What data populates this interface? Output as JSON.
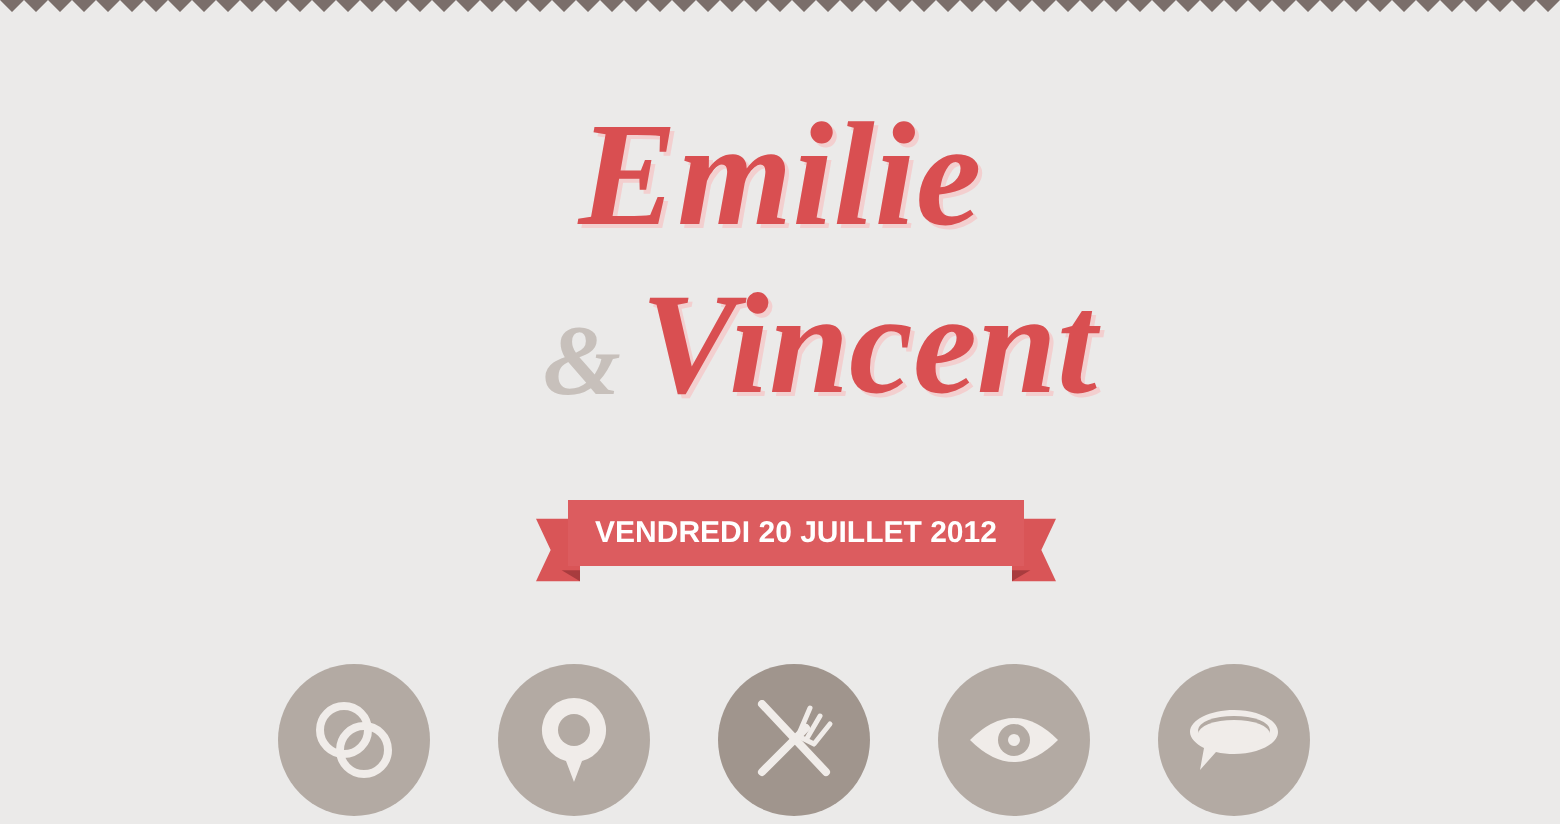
{
  "names": {
    "first": "Emilie",
    "ampersand": "&",
    "second": "Vincent"
  },
  "date": "VENDREDI 20 JUILLET 2012",
  "nav": [
    {
      "kind": "rings",
      "selected": false
    },
    {
      "kind": "pin",
      "selected": false
    },
    {
      "kind": "cutlery",
      "selected": true
    },
    {
      "kind": "eye",
      "selected": false
    },
    {
      "kind": "speech",
      "selected": false
    }
  ]
}
